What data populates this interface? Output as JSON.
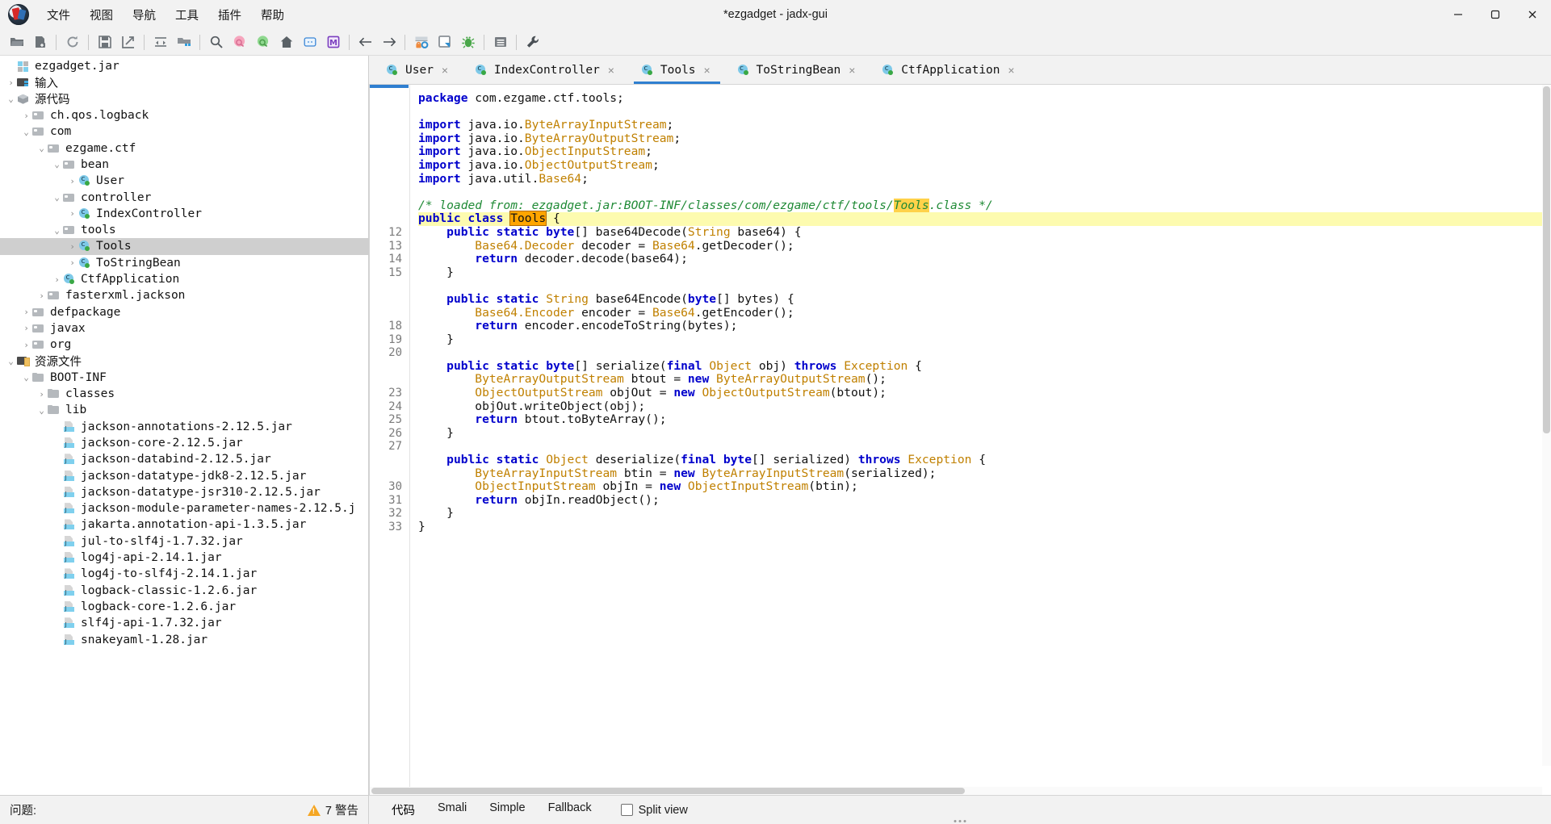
{
  "window": {
    "title": "*ezgadget - jadx-gui",
    "logo_icon": "jadx-logo-icon",
    "controls": [
      {
        "name": "minimize-button",
        "icon": "minimize-icon"
      },
      {
        "name": "maximize-button",
        "icon": "maximize-icon"
      },
      {
        "name": "close-button",
        "icon": "close-icon"
      }
    ]
  },
  "menubar": [
    {
      "label": "文件",
      "name": "menu-file"
    },
    {
      "label": "视图",
      "name": "menu-view"
    },
    {
      "label": "导航",
      "name": "menu-navigation"
    },
    {
      "label": "工具",
      "name": "menu-tools"
    },
    {
      "label": "插件",
      "name": "menu-plugins"
    },
    {
      "label": "帮助",
      "name": "menu-help"
    }
  ],
  "toolbar": [
    {
      "icon": "open-folder-icon",
      "name": "open-file-button"
    },
    {
      "icon": "add-files-icon",
      "name": "add-files-button"
    },
    {
      "sep": true
    },
    {
      "icon": "reload-icon",
      "name": "reload-button"
    },
    {
      "sep": true
    },
    {
      "icon": "save-icon",
      "name": "save-button"
    },
    {
      "icon": "export-icon",
      "name": "export-button"
    },
    {
      "sep": true
    },
    {
      "icon": "collapse-all-icon",
      "name": "collapse-all-button"
    },
    {
      "icon": "expand-all-icon",
      "name": "expand-all-button"
    },
    {
      "sep": true
    },
    {
      "icon": "search-icon",
      "name": "search-button"
    },
    {
      "icon": "search-pink-icon",
      "name": "text-search-button"
    },
    {
      "icon": "search-green-icon",
      "name": "class-search-button"
    },
    {
      "icon": "home-icon",
      "name": "home-button"
    },
    {
      "icon": "comment-icon",
      "name": "comments-button"
    },
    {
      "icon": "mark-icon",
      "name": "mark-button"
    },
    {
      "sep": true
    },
    {
      "icon": "arrow-left-icon",
      "name": "back-button"
    },
    {
      "icon": "arrow-right-icon",
      "name": "forward-button"
    },
    {
      "sep": true
    },
    {
      "icon": "deobfuscation-icon",
      "name": "deobfuscation-button"
    },
    {
      "icon": "quark-icon",
      "name": "quark-button"
    },
    {
      "icon": "bug-icon",
      "name": "debug-button"
    },
    {
      "sep": true
    },
    {
      "icon": "log-icon",
      "name": "log-button"
    },
    {
      "sep": true
    },
    {
      "icon": "wrench-icon",
      "name": "preferences-button"
    }
  ],
  "tree": [
    {
      "depth": 0,
      "twisty": "",
      "icon": "jar-root-icon",
      "label": "ezgadget.jar",
      "selected": false
    },
    {
      "depth": 0,
      "twisty": "›",
      "icon": "folder-blue-icon",
      "label": "输入",
      "selected": false,
      "cjk": true
    },
    {
      "depth": 0,
      "twisty": "⌄",
      "icon": "cube-icon",
      "label": "源代码",
      "selected": false,
      "cjk": true
    },
    {
      "depth": 1,
      "twisty": "›",
      "icon": "package-icon",
      "label": "ch.qos.logback",
      "selected": false
    },
    {
      "depth": 1,
      "twisty": "⌄",
      "icon": "package-icon",
      "label": "com",
      "selected": false
    },
    {
      "depth": 2,
      "twisty": "⌄",
      "icon": "package-icon",
      "label": "ezgame.ctf",
      "selected": false
    },
    {
      "depth": 3,
      "twisty": "⌄",
      "icon": "package-icon",
      "label": "bean",
      "selected": false
    },
    {
      "depth": 4,
      "twisty": "›",
      "icon": "class-icon",
      "label": "User",
      "selected": false
    },
    {
      "depth": 3,
      "twisty": "⌄",
      "icon": "package-icon",
      "label": "controller",
      "selected": false
    },
    {
      "depth": 4,
      "twisty": "›",
      "icon": "class-icon",
      "label": "IndexController",
      "selected": false
    },
    {
      "depth": 3,
      "twisty": "⌄",
      "icon": "package-icon",
      "label": "tools",
      "selected": false
    },
    {
      "depth": 4,
      "twisty": "›",
      "icon": "class-icon",
      "label": "Tools",
      "selected": true
    },
    {
      "depth": 4,
      "twisty": "›",
      "icon": "class-icon",
      "label": "ToStringBean",
      "selected": false
    },
    {
      "depth": 3,
      "twisty": "›",
      "icon": "class-icon",
      "label": "CtfApplication",
      "selected": false
    },
    {
      "depth": 2,
      "twisty": "›",
      "icon": "package-icon",
      "label": "fasterxml.jackson",
      "selected": false
    },
    {
      "depth": 1,
      "twisty": "›",
      "icon": "package-icon",
      "label": "defpackage",
      "selected": false
    },
    {
      "depth": 1,
      "twisty": "›",
      "icon": "package-icon",
      "label": "javax",
      "selected": false
    },
    {
      "depth": 1,
      "twisty": "›",
      "icon": "package-icon",
      "label": "org",
      "selected": false
    },
    {
      "depth": 0,
      "twisty": "⌄",
      "icon": "resources-icon",
      "label": "资源文件",
      "selected": false,
      "cjk": true
    },
    {
      "depth": 1,
      "twisty": "⌄",
      "icon": "folder-plain-icon",
      "label": "BOOT-INF",
      "selected": false
    },
    {
      "depth": 2,
      "twisty": "›",
      "icon": "folder-plain-icon",
      "label": "classes",
      "selected": false
    },
    {
      "depth": 2,
      "twisty": "⌄",
      "icon": "folder-plain-icon",
      "label": "lib",
      "selected": false
    },
    {
      "depth": 3,
      "twisty": "",
      "icon": "jar-file-icon",
      "label": "jackson-annotations-2.12.5.jar",
      "selected": false
    },
    {
      "depth": 3,
      "twisty": "",
      "icon": "jar-file-icon",
      "label": "jackson-core-2.12.5.jar",
      "selected": false
    },
    {
      "depth": 3,
      "twisty": "",
      "icon": "jar-file-icon",
      "label": "jackson-databind-2.12.5.jar",
      "selected": false
    },
    {
      "depth": 3,
      "twisty": "",
      "icon": "jar-file-icon",
      "label": "jackson-datatype-jdk8-2.12.5.jar",
      "selected": false
    },
    {
      "depth": 3,
      "twisty": "",
      "icon": "jar-file-icon",
      "label": "jackson-datatype-jsr310-2.12.5.jar",
      "selected": false
    },
    {
      "depth": 3,
      "twisty": "",
      "icon": "jar-file-icon",
      "label": "jackson-module-parameter-names-2.12.5.j",
      "selected": false
    },
    {
      "depth": 3,
      "twisty": "",
      "icon": "jar-file-icon",
      "label": "jakarta.annotation-api-1.3.5.jar",
      "selected": false
    },
    {
      "depth": 3,
      "twisty": "",
      "icon": "jar-file-icon",
      "label": "jul-to-slf4j-1.7.32.jar",
      "selected": false
    },
    {
      "depth": 3,
      "twisty": "",
      "icon": "jar-file-icon",
      "label": "log4j-api-2.14.1.jar",
      "selected": false
    },
    {
      "depth": 3,
      "twisty": "",
      "icon": "jar-file-icon",
      "label": "log4j-to-slf4j-2.14.1.jar",
      "selected": false
    },
    {
      "depth": 3,
      "twisty": "",
      "icon": "jar-file-icon",
      "label": "logback-classic-1.2.6.jar",
      "selected": false
    },
    {
      "depth": 3,
      "twisty": "",
      "icon": "jar-file-icon",
      "label": "logback-core-1.2.6.jar",
      "selected": false
    },
    {
      "depth": 3,
      "twisty": "",
      "icon": "jar-file-icon",
      "label": "slf4j-api-1.7.32.jar",
      "selected": false
    },
    {
      "depth": 3,
      "twisty": "",
      "icon": "jar-file-icon",
      "label": "snakeyaml-1.28.jar",
      "selected": false
    }
  ],
  "problems": {
    "label": "问题:",
    "warning_count_text": "7 警告",
    "warning_icon": "warning-triangle-icon"
  },
  "tabs": [
    {
      "label": "User",
      "icon": "class-icon",
      "active": false,
      "close": "×"
    },
    {
      "label": "IndexController",
      "icon": "class-icon",
      "active": false,
      "close": "×"
    },
    {
      "label": "Tools",
      "icon": "class-icon",
      "active": true,
      "close": "×"
    },
    {
      "label": "ToStringBean",
      "icon": "class-icon",
      "active": false,
      "close": "×"
    },
    {
      "label": "CtfApplication",
      "icon": "class-icon",
      "active": false,
      "close": "×"
    }
  ],
  "editor": {
    "gutter": [
      "",
      "",
      "",
      "",
      "",
      "",
      "",
      "",
      "",
      "",
      "12",
      "13",
      "14",
      "15",
      "",
      "",
      "",
      "18",
      "19",
      "20",
      "",
      "",
      "23",
      "24",
      "25",
      "26",
      "27",
      "",
      "",
      "30",
      "31",
      "32",
      "33",
      "",
      ""
    ],
    "lines": [
      {
        "html": "<span class=\"kw\">package</span> com.ezgame.ctf.tools;"
      },
      {
        "html": ""
      },
      {
        "html": "<span class=\"kw\">import</span> java.io.<span class=\"typ\">ByteArrayInputStream</span>;"
      },
      {
        "html": "<span class=\"kw\">import</span> java.io.<span class=\"typ\">ByteArrayOutputStream</span>;"
      },
      {
        "html": "<span class=\"kw\">import</span> java.io.<span class=\"typ\">ObjectInputStream</span>;"
      },
      {
        "html": "<span class=\"kw\">import</span> java.io.<span class=\"typ\">ObjectOutputStream</span>;"
      },
      {
        "html": "<span class=\"kw\">import</span> java.util.<span class=\"typ\">Base64</span>;"
      },
      {
        "html": ""
      },
      {
        "html": "<span class=\"cmt\">/* loaded from: ezgadget.jar:BOOT-INF/classes/com/ezgame/ctf/tools/</span><span class=\"hl-token cmt\">Tools</span><span class=\"cmt\">.class */</span>"
      },
      {
        "html": "<span class=\"kw\">public class</span> <span class=\"sel-token\">Tools</span> {",
        "highlight": true
      },
      {
        "html": "    <span class=\"kw\">public static byte</span>[] base64Decode(<span class=\"typ\">String</span> base64) {"
      },
      {
        "html": "        <span class=\"typ\">Base64.Decoder</span> decoder = <span class=\"typ\">Base64</span>.getDecoder();"
      },
      {
        "html": "        <span class=\"kw\">return</span> decoder.decode(base64);"
      },
      {
        "html": "    }"
      },
      {
        "html": ""
      },
      {
        "html": "    <span class=\"kw\">public static</span> <span class=\"typ\">String</span> base64Encode(<span class=\"kw\">byte</span>[] bytes) {"
      },
      {
        "html": "        <span class=\"typ\">Base64.Encoder</span> encoder = <span class=\"typ\">Base64</span>.getEncoder();"
      },
      {
        "html": "        <span class=\"kw\">return</span> encoder.encodeToString(bytes);"
      },
      {
        "html": "    }"
      },
      {
        "html": ""
      },
      {
        "html": "    <span class=\"kw\">public static</span> <span class=\"kw\">byte</span>[] serialize(<span class=\"kw\">final</span> <span class=\"typ\">Object</span> obj) <span class=\"kw\">throws</span> <span class=\"typ\">Exception</span> {"
      },
      {
        "html": "        <span class=\"typ\">ByteArrayOutputStream</span> btout = <span class=\"kw\">new</span> <span class=\"typ\">ByteArrayOutputStream</span>();"
      },
      {
        "html": "        <span class=\"typ\">ObjectOutputStream</span> objOut = <span class=\"kw\">new</span> <span class=\"typ\">ObjectOutputStream</span>(btout);"
      },
      {
        "html": "        objOut.writeObject(obj);"
      },
      {
        "html": "        <span class=\"kw\">return</span> btout.toByteArray();"
      },
      {
        "html": "    }"
      },
      {
        "html": ""
      },
      {
        "html": "    <span class=\"kw\">public static</span> <span class=\"typ\">Object</span> deserialize(<span class=\"kw\">final byte</span>[] serialized) <span class=\"kw\">throws</span> <span class=\"typ\">Exception</span> {"
      },
      {
        "html": "        <span class=\"typ\">ByteArrayInputStream</span> btin = <span class=\"kw\">new</span> <span class=\"typ\">ByteArrayInputStream</span>(serialized);"
      },
      {
        "html": "        <span class=\"typ\">ObjectInputStream</span> objIn = <span class=\"kw\">new</span> <span class=\"typ\">ObjectInputStream</span>(btin);"
      },
      {
        "html": "        <span class=\"kw\">return</span> objIn.readObject();"
      },
      {
        "html": "    }"
      },
      {
        "html": "}"
      }
    ]
  },
  "editor_bottom": {
    "modes": [
      {
        "label": "代码",
        "name": "mode-code",
        "active": true
      },
      {
        "label": "Smali",
        "name": "mode-smali",
        "active": false
      },
      {
        "label": "Simple",
        "name": "mode-simple",
        "active": false
      },
      {
        "label": "Fallback",
        "name": "mode-fallback",
        "active": false
      }
    ],
    "split_view_label": "Split view",
    "split_view_checked": false
  },
  "colors": {
    "accent": "#2f7fd0",
    "keyword": "#0000cc",
    "type": "#c08000",
    "comment": "#1f8a35",
    "highlight_line": "#fdfbaf",
    "selection": "#ffa500",
    "warning": "#f5a623"
  }
}
